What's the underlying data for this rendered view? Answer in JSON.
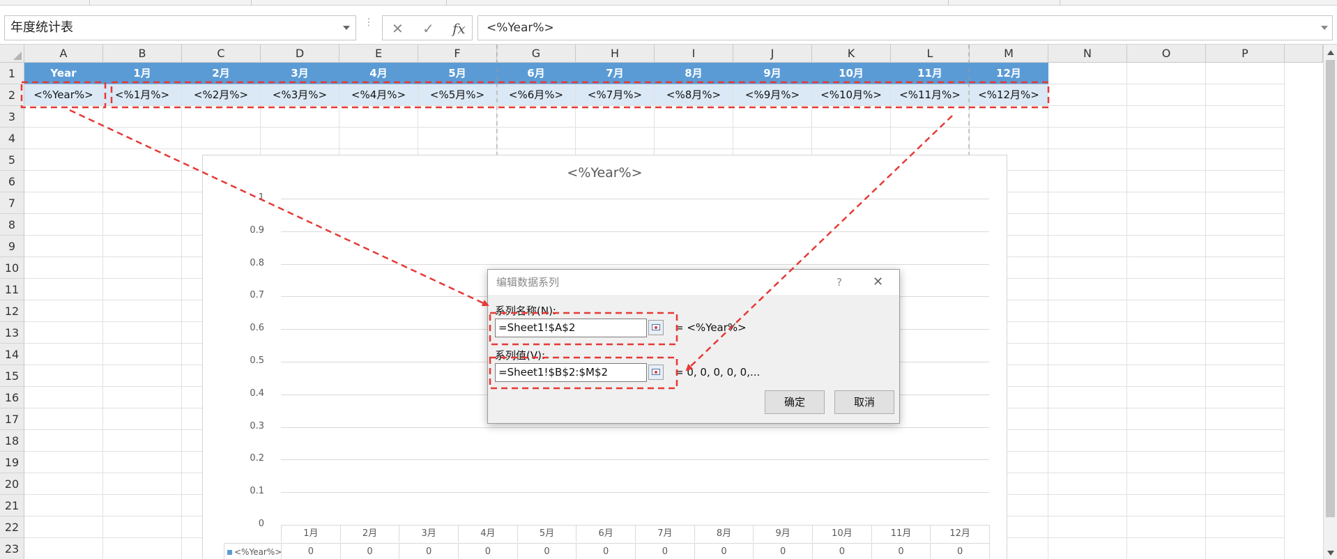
{
  "name_box": {
    "value": "年度统计表",
    "dropdown_icon": "chevron-down-icon"
  },
  "formula_bar": {
    "cancel_icon": "✕",
    "enter_icon": "✓",
    "fx_label": "fx",
    "value": "<%Year%>"
  },
  "columns": [
    "A",
    "B",
    "C",
    "D",
    "E",
    "F",
    "G",
    "H",
    "I",
    "J",
    "K",
    "L",
    "M",
    "N",
    "O",
    "P"
  ],
  "rows": [
    "1",
    "2",
    "3",
    "4",
    "5",
    "6",
    "7",
    "8",
    "9",
    "10",
    "11",
    "12",
    "13",
    "14",
    "15",
    "16",
    "17",
    "18",
    "19",
    "20",
    "21",
    "22",
    "23"
  ],
  "sheet": {
    "header_row": [
      "Year",
      "1月",
      "2月",
      "3月",
      "4月",
      "5月",
      "6月",
      "7月",
      "8月",
      "9月",
      "10月",
      "11月",
      "12月"
    ],
    "data_row": [
      "<%Year%>",
      "<%1月%>",
      "<%2月%>",
      "<%3月%>",
      "<%4月%>",
      "<%5月%>",
      "<%6月%>",
      "<%7月%>",
      "<%8月%>",
      "<%9月%>",
      "<%10月%>",
      "<%11月%>",
      "<%12月%>"
    ],
    "header_color": "#5b9bd5",
    "data_color": "#dbe9f6"
  },
  "chart": {
    "title": "<%Year%>",
    "legend_label": "<%Year%>"
  },
  "chart_data": {
    "type": "table",
    "title": "<%Year%>",
    "categories": [
      "1月",
      "2月",
      "3月",
      "4月",
      "5月",
      "6月",
      "7月",
      "8月",
      "9月",
      "10月",
      "11月",
      "12月"
    ],
    "series": [
      {
        "name": "<%Year%>",
        "values": [
          0,
          0,
          0,
          0,
          0,
          0,
          0,
          0,
          0,
          0,
          0,
          0
        ]
      }
    ],
    "ylim": [
      0,
      1
    ],
    "yticks": [
      "1",
      "0.9",
      "0.8",
      "0.7",
      "0.6",
      "0.5",
      "0.4",
      "0.3",
      "0.2",
      "0.1",
      "0"
    ],
    "grid": true,
    "legend": "data-table"
  },
  "dialog": {
    "title": "编辑数据系列",
    "help": "?",
    "close": "✕",
    "name_label": "系列名称(N):",
    "name_value": "=Sheet1!$A$2",
    "name_result": "= <%Year%>",
    "values_label": "系列值(V):",
    "values_value": "=Sheet1!$B$2:$M$2",
    "values_result": "= 0, 0, 0, 0, 0,...",
    "ok": "确定",
    "cancel": "取消"
  },
  "annotation_color": "#e53935"
}
